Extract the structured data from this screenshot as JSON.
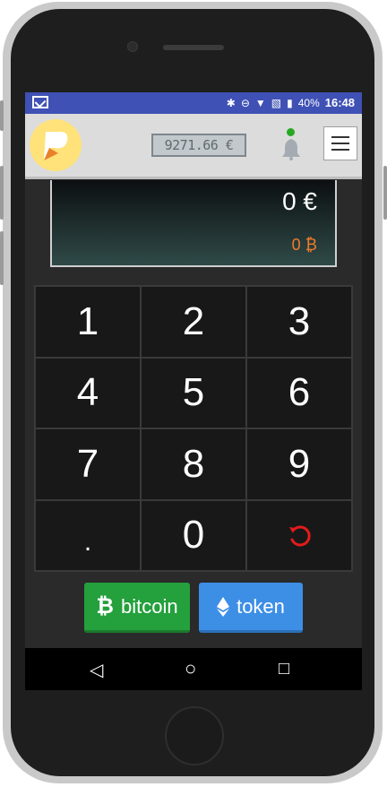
{
  "statusbar": {
    "icons": [
      "mail-icon",
      "bluetooth-icon",
      "dnd-icon",
      "wifi-icon",
      "no-sim-icon",
      "battery-icon"
    ],
    "battery": "40%",
    "time": "16:48"
  },
  "appbar": {
    "balance": "9271.66 €",
    "bell_status_color": "#27a822"
  },
  "display": {
    "amount_eur": "0 €",
    "amount_btc": "0 ₿"
  },
  "keypad": {
    "keys": [
      "1",
      "2",
      "3",
      "4",
      "5",
      "6",
      "7",
      "8",
      "9",
      ".",
      "0"
    ],
    "undo_icon": "undo-icon"
  },
  "actions": {
    "bitcoin_icon": "₿",
    "bitcoin_label": "bitcoin",
    "token_label": "token"
  },
  "navbar": {
    "back": "◁",
    "home": "○",
    "recents": "□"
  },
  "colors": {
    "statusbar": "#3f51b5",
    "bitcoin_button": "#24a03c",
    "token_button": "#3d8fe6",
    "btc_amount": "#f07b2a",
    "undo": "#e21b1b"
  }
}
